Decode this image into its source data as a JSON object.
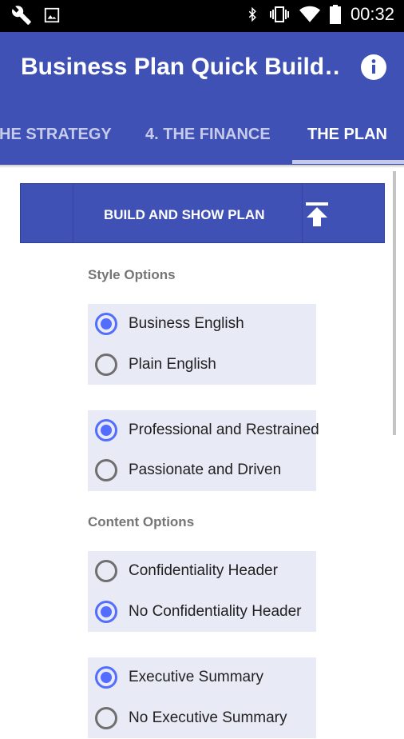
{
  "status_bar": {
    "time": "00:32",
    "left_icons": [
      "wrench-icon",
      "image-icon"
    ],
    "right_icons": [
      "bluetooth-icon",
      "vibrate-icon",
      "wifi-icon",
      "battery-icon"
    ]
  },
  "app_bar": {
    "title": "Business Plan Quick Build…",
    "info_icon": "info-icon"
  },
  "tabs": [
    {
      "label": "HE STRATEGY",
      "active": false
    },
    {
      "label": "4. THE FINANCE",
      "active": false
    },
    {
      "label": "THE PLAN",
      "active": true
    }
  ],
  "build_bar": {
    "label": "BUILD AND SHOW PLAN",
    "icon": "upload-to-top-icon"
  },
  "sections": {
    "style_title": "Style Options",
    "content_title": "Content Options"
  },
  "groups": [
    {
      "options": [
        {
          "label": "Business English",
          "checked": true
        },
        {
          "label": "Plain English",
          "checked": false
        }
      ]
    },
    {
      "options": [
        {
          "label": "Professional and Restrained",
          "checked": true
        },
        {
          "label": "Passionate and Driven",
          "checked": false
        }
      ]
    },
    {
      "options": [
        {
          "label": "Confidentiality Header",
          "checked": false
        },
        {
          "label": "No Confidentiality Header",
          "checked": true
        }
      ]
    },
    {
      "options": [
        {
          "label": "Executive Summary",
          "checked": true
        },
        {
          "label": "No Executive Summary",
          "checked": false
        }
      ]
    }
  ],
  "colors": {
    "primary": "#3f51b5",
    "accent": "#536dfe",
    "group_bg": "#e8eaf6",
    "section_text": "#757575"
  }
}
